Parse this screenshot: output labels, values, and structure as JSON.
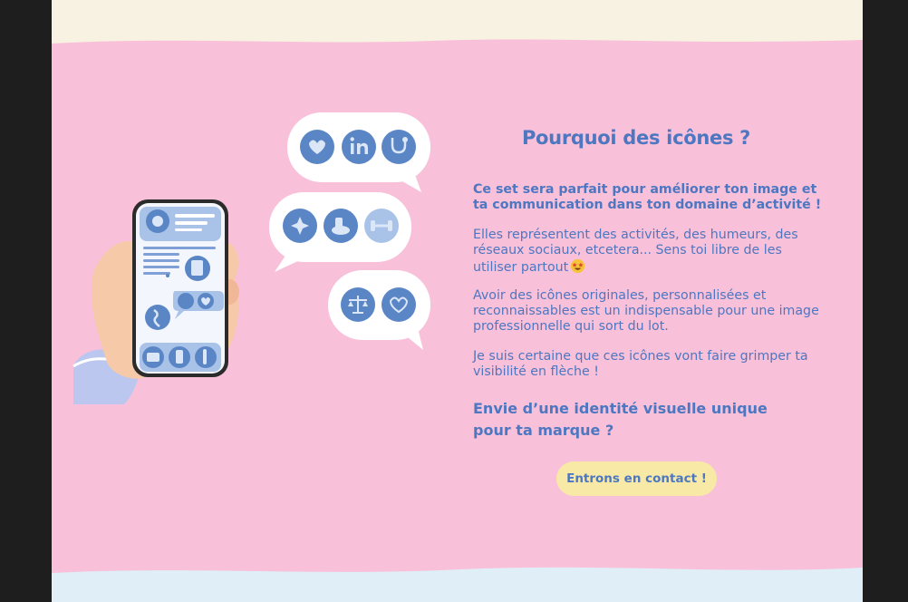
{
  "section": {
    "heading": "Pourquoi des icônes ?",
    "intro": "Ce set sera parfait pour améliorer ton image et ta communication dans ton domaine d’activité !",
    "description": " Elles représentent des activités, des humeurs, des réseaux sociaux, etcetera... Sens toi libre de les utiliser partout",
    "benefit": "Avoir des icônes originales, personnalisées et reconnaissables est un indispensable pour une image professionnelle qui sort du lot.",
    "promise": "Je suis certaine que ces icônes vont faire grimper ta visibilité en flèche !",
    "cta_question": "Envie d’une identité visuelle unique pour ta marque ?",
    "cta_button": "Entrons en contact !"
  },
  "icons": {
    "bubble_1": [
      "heart-icon",
      "linkedin-icon",
      "stethoscope-icon"
    ],
    "bubble_2": [
      "sparkles-icon",
      "cosmetic-jar-icon",
      "dumbbell-icon"
    ],
    "bubble_3": [
      "scales-icon",
      "leaf-heart-icon"
    ],
    "phone": [
      "profile-icon",
      "clipboard-icon",
      "yoga-icon",
      "heart-bubble-icon",
      "dancer-icon",
      "youtube-icon",
      "phone-icon",
      "pinterest-icon"
    ],
    "emoji": "star-struck-emoji-icon"
  },
  "colors": {
    "page_background": "#f9c0da",
    "top_band": "#f7f2e2",
    "bottom_band": "#dfeef7",
    "text_blue": "#4d77c0",
    "icon_blue": "#5b86c6",
    "button_yellow": "#f8eaa6",
    "outer_background": "#1e1e1e"
  }
}
